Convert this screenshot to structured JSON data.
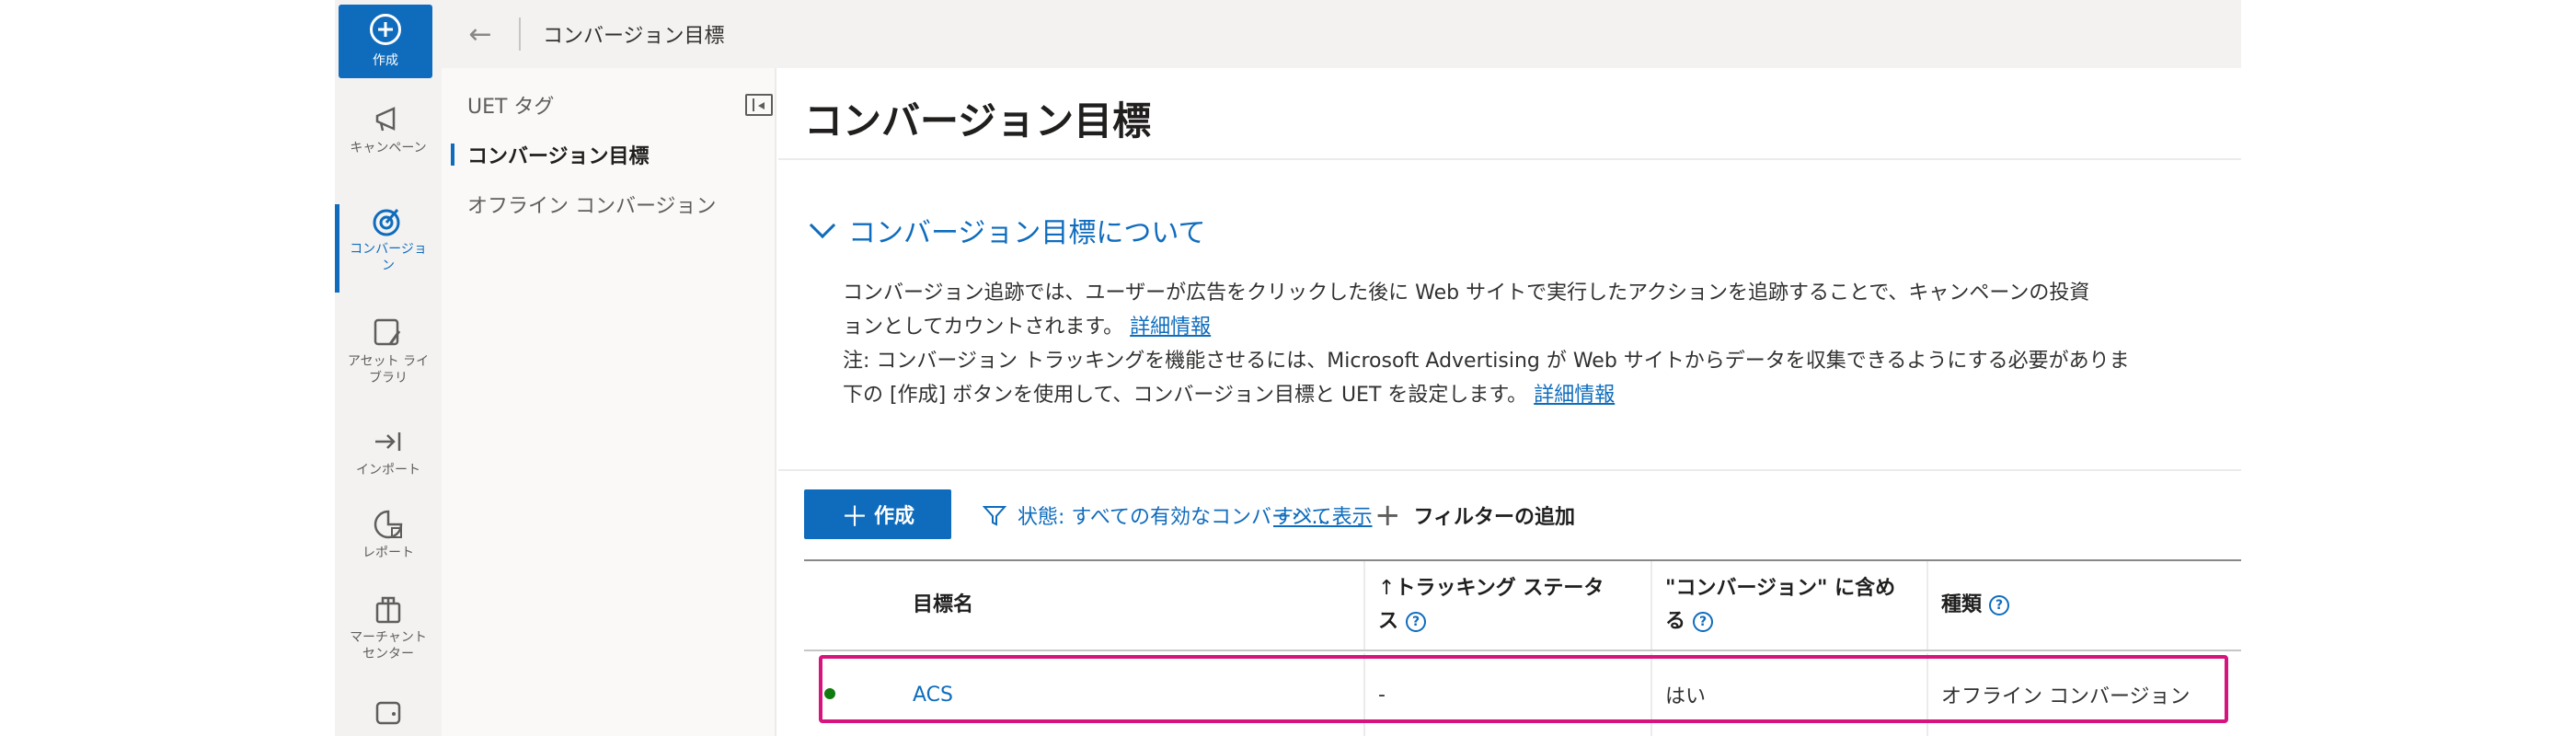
{
  "rail": {
    "create_label": "作成",
    "items": [
      {
        "label": "キャンペーン",
        "icon": "megaphone-icon"
      },
      {
        "label": "コンバージョン",
        "icon": "target-icon"
      },
      {
        "label": "アセット ライブラリ",
        "icon": "asset-library-icon"
      },
      {
        "label": "インポート",
        "icon": "import-icon"
      },
      {
        "label": "レポート",
        "icon": "report-icon"
      },
      {
        "label": "マーチャント センター",
        "icon": "shopping-bag-icon"
      }
    ]
  },
  "topbar": {
    "title": "コンバージョン目標"
  },
  "subnav": {
    "items": [
      "UET タグ",
      "コンバージョン目標",
      "オフライン コンバージョン"
    ],
    "active_index": 1
  },
  "main": {
    "title": "コンバージョン目標",
    "about": {
      "toggle_label": "コンバージョン目標について",
      "line1": "コンバージョン追跡では、ユーザーが広告をクリックした後に Web サイトで実行したアクションを追跡することで、キャンペーンの投資",
      "line2": "ョンとしてカウントされます。",
      "line2_link": "詳細情報",
      "line3": "注: コンバージョン トラッキングを機能させるには、Microsoft Advertising が Web サイトからデータを収集できるようにする必要がありま",
      "line4": "下の [作成] ボタンを使用して、コンバージョン目標と UET を設定します。",
      "line4_link": "詳細情報"
    },
    "toolbar": {
      "create_label": "作成",
      "filter_label": "状態: すべての有効なコンバージ...",
      "show_all": "すべて表示",
      "add_filter": "フィルターの追加"
    },
    "table": {
      "columns": {
        "name": "目標名",
        "tracking_arrow": "↑",
        "tracking_line1": "トラッキング ステータ",
        "tracking_line2": "ス",
        "include_line1": "\"コンバージョン\" に含め",
        "include_line2": "る",
        "type": "種類"
      },
      "rows": [
        {
          "status_color": "#107c10",
          "name": "ACS",
          "tracking": "-",
          "include": "はい",
          "type": "オフライン コンバージョン"
        }
      ]
    }
  },
  "colors": {
    "accent": "#0f6cbd",
    "highlight": "#d6147e"
  }
}
